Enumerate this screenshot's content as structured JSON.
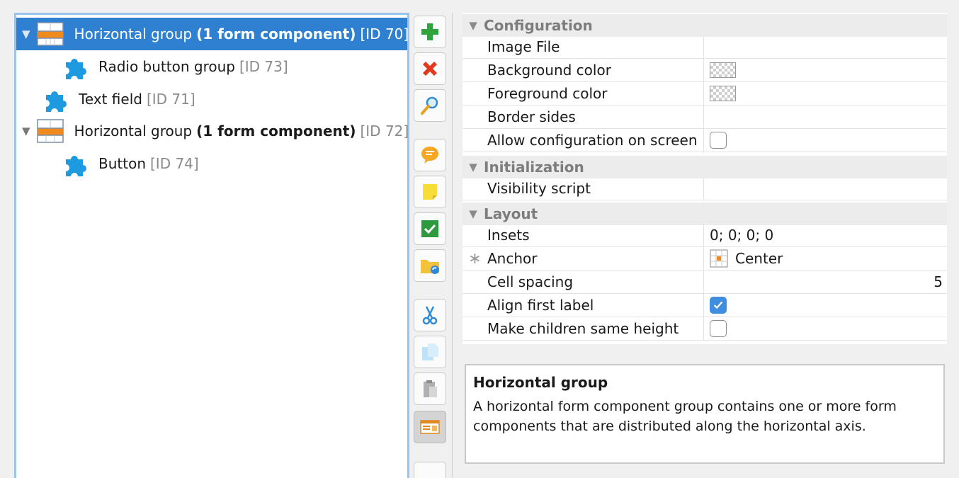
{
  "tree": {
    "items": [
      {
        "name": "Horizontal group",
        "bold": "(1 form component)",
        "id": "[ID 70]",
        "toggle": "▼",
        "icon": "horizontal-group-icon"
      },
      {
        "name": "Radio button group",
        "bold": "",
        "id": "[ID 73]",
        "toggle": "",
        "icon": "puzzle-icon"
      },
      {
        "name": "Text field",
        "bold": "",
        "id": "[ID 71]",
        "toggle": "",
        "icon": "puzzle-icon"
      },
      {
        "name": "Horizontal group",
        "bold": "(1 form component)",
        "id": "[ID 72]",
        "toggle": "▼",
        "icon": "horizontal-group-icon"
      },
      {
        "name": "Button",
        "bold": "",
        "id": "[ID 74]",
        "toggle": "",
        "icon": "puzzle-icon"
      }
    ]
  },
  "toolbar": {
    "buttons": [
      "add-icon",
      "delete-icon",
      "search-icon",
      "comment-icon",
      "note-icon",
      "check-icon",
      "folder-sync-icon",
      "cut-icon",
      "copy-icon",
      "paste-icon",
      "form-preview-icon"
    ]
  },
  "props": {
    "sections": [
      {
        "title": "Configuration",
        "rows": [
          {
            "name": "Image File",
            "value": "",
            "kind": "text"
          },
          {
            "name": "Background color",
            "value": "",
            "kind": "swatch"
          },
          {
            "name": "Foreground color",
            "value": "",
            "kind": "swatch"
          },
          {
            "name": "Border sides",
            "value": "",
            "kind": "text"
          },
          {
            "name": "Allow configuration on screen",
            "value": "",
            "kind": "checkbox",
            "checked": false
          }
        ]
      },
      {
        "title": "Initialization",
        "rows": [
          {
            "name": "Visibility script",
            "value": "",
            "kind": "text"
          }
        ]
      },
      {
        "title": "Layout",
        "rows": [
          {
            "name": "Insets",
            "value": "0; 0; 0; 0",
            "kind": "text"
          },
          {
            "name": "Anchor",
            "value": "Center",
            "kind": "anchor",
            "marker": "∗"
          },
          {
            "name": "Cell spacing",
            "value": "5",
            "kind": "number"
          },
          {
            "name": "Align first label",
            "value": "",
            "kind": "checkbox",
            "checked": true
          },
          {
            "name": "Make children same height",
            "value": "",
            "kind": "checkbox",
            "checked": false
          }
        ]
      }
    ]
  },
  "description": {
    "title": "Horizontal group",
    "text": "A horizontal form component group contains one or more form components that are distributed along the horizontal axis."
  },
  "colors": {
    "selection": "#2f80d0",
    "tree_border": "#9cc3ea",
    "section_text": "#7d7d7d",
    "checkbox_on": "#3f8ee0"
  }
}
